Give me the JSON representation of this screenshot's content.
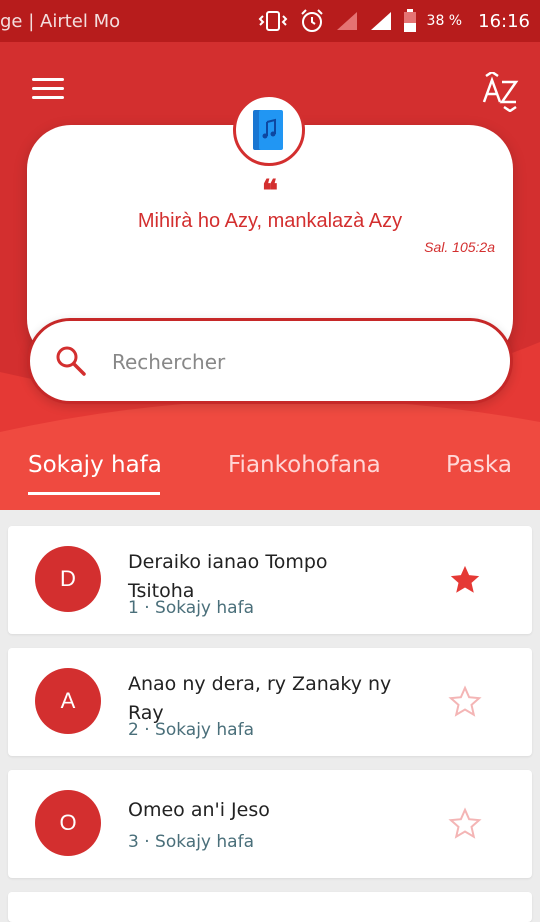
{
  "status_bar": {
    "carrier": "ge | Airtel Mo",
    "battery": "38 %",
    "time": "16:16",
    "icons": [
      "vibrate-icon",
      "alarm-icon",
      "signal-icon",
      "signal-icon",
      "battery-icon"
    ]
  },
  "toolbar": {
    "menu_icon": "menu-icon",
    "sort_label": "AZ"
  },
  "verse": {
    "text": "Mihirà ho Azy, mankalazà Azy",
    "reference": "Sal. 105:2a"
  },
  "search": {
    "placeholder": "Rechercher"
  },
  "tabs": [
    {
      "label": "Sokajy hafa",
      "active": true
    },
    {
      "label": "Fiankohofana",
      "active": false
    },
    {
      "label": "Paska",
      "active": false
    }
  ],
  "songs": [
    {
      "letter": "D",
      "title": "Deraiko ianao Tompo Tsitoha",
      "number": "1",
      "category": "Sokajy hafa",
      "favorite": true
    },
    {
      "letter": "A",
      "title": "Anao ny dera, ry Zanaky ny Ray",
      "number": "2",
      "category": "Sokajy hafa",
      "favorite": false
    },
    {
      "letter": "O",
      "title": "Omeo an'i Jeso",
      "number": "3",
      "category": "Sokajy hafa",
      "favorite": false
    }
  ],
  "colors": {
    "primary": "#d32f2f",
    "status_bar": "#b71c1c",
    "meta_text": "#4a6f7a"
  }
}
